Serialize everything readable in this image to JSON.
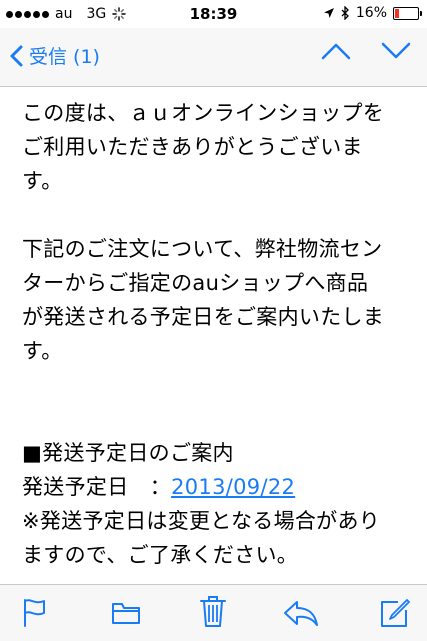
{
  "status": {
    "carrier": "au",
    "network": "3G",
    "time": "18:39",
    "battery": "16%",
    "battery_level": 0.16,
    "signal_bars": 5
  },
  "nav": {
    "back_label": "受信 (1)"
  },
  "message": {
    "p1": [
      "この度は、ａｕオンラインショップを",
      "ご利用いただきありがとうございま",
      "す。"
    ],
    "p2": [
      "下記のご注文について、弊社物流セン",
      "ターからご指定のauショップへ商品",
      "が発送される予定日をご案内いたしま",
      "す。"
    ],
    "section_title": "■発送予定日のご案内",
    "date_label": "発送予定日　：",
    "date_value": "2013/09/22",
    "note": [
      "※発送予定日は変更となる場合があり",
      "ますので、ご了承ください。"
    ]
  },
  "colors": {
    "accent": "#1a7cf5",
    "battery_low": "#ff2d20"
  },
  "icons": {
    "toolbar": [
      "flag-icon",
      "folder-icon",
      "trash-icon",
      "reply-icon",
      "compose-icon"
    ]
  }
}
